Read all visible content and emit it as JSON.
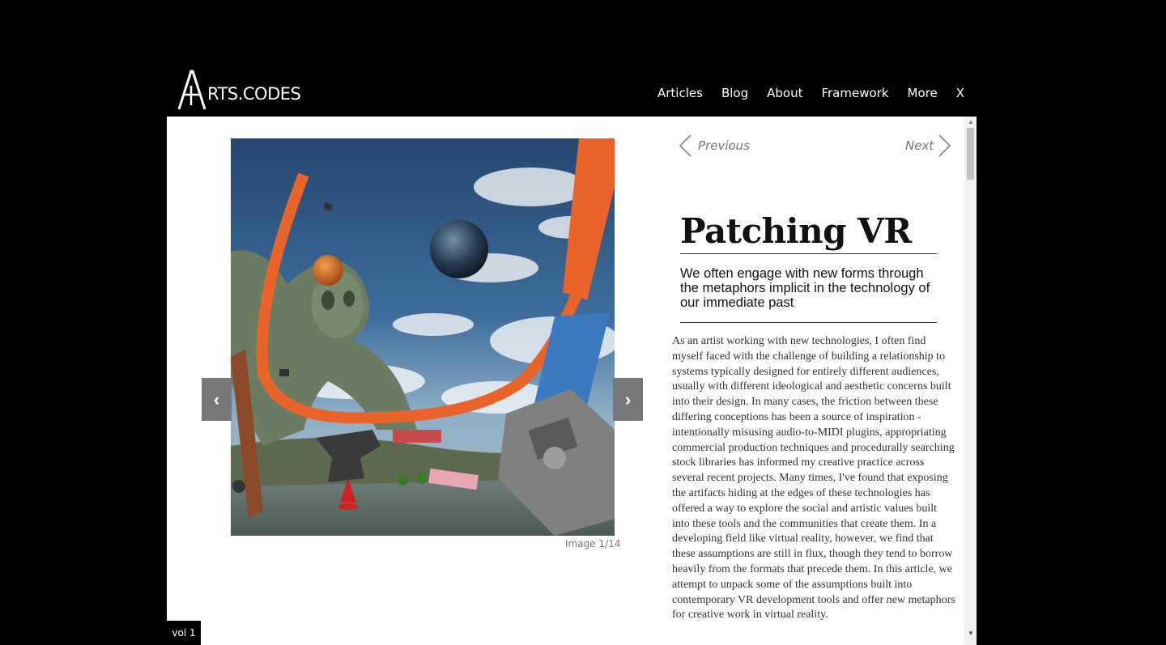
{
  "header": {
    "logo_letter": "A",
    "logo_text": "RTS.CODES",
    "nav": [
      "Articles",
      "Blog",
      "About",
      "Framework",
      "More",
      "X"
    ]
  },
  "gallery": {
    "prev_arrow": "‹",
    "next_arrow": "›",
    "caption": "Image 1/14",
    "icons": {
      "prev": "chevron-left-icon",
      "next": "chevron-right-icon"
    }
  },
  "article_nav": {
    "previous": "Previous",
    "next": "Next"
  },
  "article": {
    "title": "Patching VR",
    "subtitle": "We often engage with new forms through the metaphors implicit in the technology of our immediate past",
    "body": "As an artist working with new technologies, I often find myself faced with the challenge of building a relationship to systems typically designed for entirely different audiences, usually with different ideological and aesthetic concerns built into their design. In many cases, the friction between these differing conceptions has been a source of inspiration - intentionally misusing audio-to-MIDI plugins, appropriating commercial production techniques and procedurally searching stock libraries has informed my creative practice across several recent projects. Many times, I've found that exposing the artifacts hiding at the edges of these technologies has offered a way to explore the social and artistic values built into these tools and the communities that create them. In a developing field like virtual reality, however, we find that these assumptions are still in flux, though they tend to borrow heavily from the formats that precede them. In this article, we attempt to unpack some of the assumptions built into contemporary VR development tools and offer new metaphors for creative work in virtual reality."
  },
  "footer": {
    "volume": "vol 1"
  },
  "colors": {
    "background": "#000000",
    "panel": "#ffffff",
    "arrow_button": "#777777",
    "orange": "#e8642a"
  }
}
